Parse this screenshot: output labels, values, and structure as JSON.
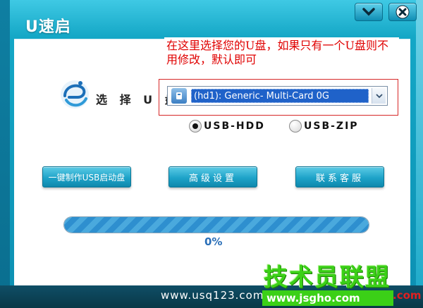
{
  "window": {
    "title": "U速启",
    "minimize_icon": "chevron-down-icon",
    "close_icon": "close-icon"
  },
  "annotation": {
    "text": "在这里选择您的U盘，如果只有一个U盘则不用修改，默认即可",
    "color": "#e00000"
  },
  "disk_select": {
    "label": "选 择 U 盘",
    "value": "(hd1): Generic- Multi-Card 0G",
    "icon": "usb-drive-icon"
  },
  "modes": [
    {
      "label": "USB-HDD",
      "selected": true
    },
    {
      "label": "USB-ZIP",
      "selected": false
    }
  ],
  "buttons": {
    "make": "一键制作USB启动盘",
    "advanced": "高级设置",
    "support": "联系客服"
  },
  "progress": {
    "value": 0,
    "text": "0%"
  },
  "footer": {
    "url": "www.usq123.com"
  },
  "watermark": {
    "title": "技术员联盟",
    "site": "www.jsgho.com",
    "suffix": ".com"
  },
  "colors": {
    "accent": "#14a7c6",
    "footer": "#093847",
    "watermark": "#3bd017"
  }
}
